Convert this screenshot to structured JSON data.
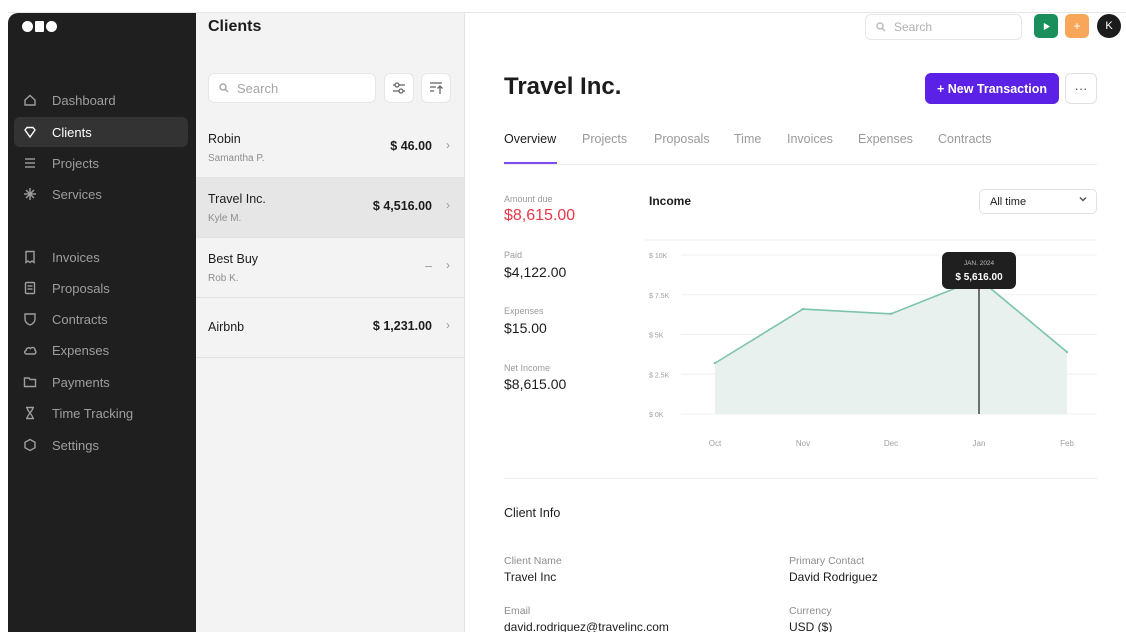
{
  "sidebar": {
    "items": [
      {
        "label": "Dashboard",
        "icon": "home-icon"
      },
      {
        "label": "Clients",
        "icon": "heart-icon",
        "active": true
      },
      {
        "label": "Projects",
        "icon": "list-icon"
      },
      {
        "label": "Services",
        "icon": "sparkle-icon"
      },
      {
        "label": "Invoices",
        "icon": "receipt-icon"
      },
      {
        "label": "Proposals",
        "icon": "document-icon"
      },
      {
        "label": "Contracts",
        "icon": "shield-icon"
      },
      {
        "label": "Expenses",
        "icon": "cloud-icon"
      },
      {
        "label": "Payments",
        "icon": "folder-icon"
      },
      {
        "label": "Time Tracking",
        "icon": "hourglass-icon"
      },
      {
        "label": "Settings",
        "icon": "hexagon-icon"
      }
    ]
  },
  "clients": {
    "title": "Clients",
    "search_placeholder": "Search",
    "rows": [
      {
        "name": "Robin",
        "contact": "Samantha P.",
        "amount": "$ 46.00"
      },
      {
        "name": "Travel Inc.",
        "contact": "Kyle M.",
        "amount": "$ 4,516.00",
        "selected": true
      },
      {
        "name": "Best Buy",
        "contact": "Rob K.",
        "amount": "–"
      },
      {
        "name": "Airbnb",
        "contact": "",
        "amount": "$ 1,231.00"
      }
    ]
  },
  "topbar": {
    "search_placeholder": "Search",
    "play_color": "#1a8f5b",
    "add_color": "#f7a65a",
    "avatar_initial": "K"
  },
  "main": {
    "title": "Travel Inc.",
    "new_transaction": "+ New Transaction",
    "more": "···",
    "tabs": [
      "Overview",
      "Projects",
      "Proposals",
      "Time",
      "Invoices",
      "Expenses",
      "Contracts"
    ],
    "stats": {
      "amount_due_label": "Amount due",
      "amount_due": "$8,615.00",
      "paid_label": "Paid",
      "paid": "$4,122.00",
      "expenses_label": "Expenses",
      "expenses": "$15.00",
      "net_income_label": "Net Income",
      "net_income": "$8,615.00"
    },
    "income_title": "Income",
    "range": "All time",
    "client_info": {
      "title": "Client Info",
      "client_name_label": "Client Name",
      "client_name": "Travel Inc",
      "primary_contact_label": "Primary Contact",
      "primary_contact": "David Rodriguez",
      "email_label": "Email",
      "email": "david.rodriguez@travelinc.com",
      "currency_label": "Currency",
      "currency": "USD ($)"
    }
  },
  "colors": {
    "accent": "#5b21e6",
    "due": "#e8374a",
    "line": "#7cc4ad",
    "area": "#e9f1ee"
  },
  "chart_data": {
    "type": "area",
    "categories": [
      "Oct",
      "Nov",
      "Dec",
      "Jan",
      "Feb"
    ],
    "values": [
      3200,
      6600,
      6300,
      8500,
      3900
    ],
    "y_ticks": [
      "$ 10K",
      "$ 7.5K",
      "$ 5K",
      "$ 2.5K",
      "$ 0K"
    ],
    "ylim": [
      0,
      10000
    ],
    "tooltip": {
      "category": "Jan",
      "date_label": "JAN. 2024",
      "value_label": "$ 5,616.00"
    },
    "grid": true
  }
}
